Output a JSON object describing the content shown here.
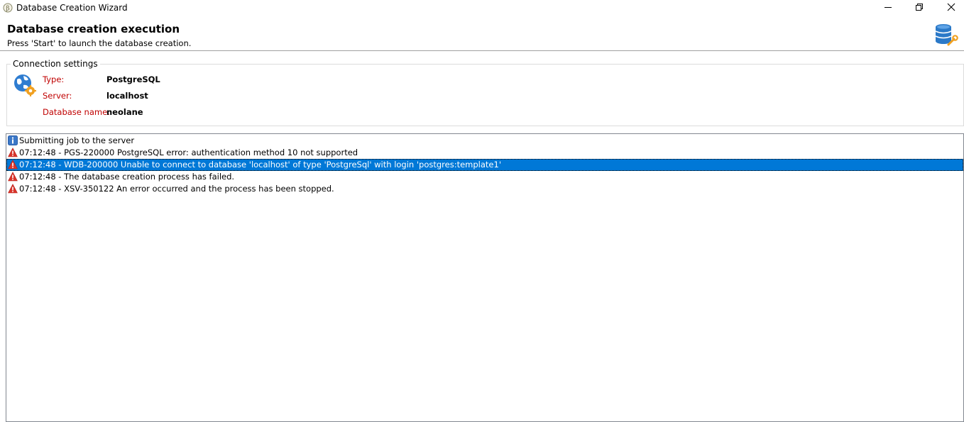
{
  "window": {
    "title": "Database Creation Wizard",
    "minimize_icon": "minimize-icon",
    "maximize_icon": "restore-icon",
    "close_icon": "close-icon"
  },
  "header": {
    "title": "Database creation execution",
    "subtitle": "Press 'Start' to launch the database creation.",
    "icon": "database-wrench-icon"
  },
  "connection": {
    "legend": "Connection settings",
    "icon": "globe-gear-icon",
    "fields": [
      {
        "label": "Type:",
        "value": "PostgreSQL"
      },
      {
        "label": "Server:",
        "value": "localhost"
      },
      {
        "label": "Database name:",
        "value": "neolane"
      }
    ]
  },
  "log": {
    "selected_index": 2,
    "rows": [
      {
        "icon": "info-icon",
        "text": "Submitting job to the server"
      },
      {
        "icon": "warning-icon",
        "text": "07:12:48 - PGS-220000 PostgreSQL error: authentication method 10 not supported"
      },
      {
        "icon": "warning-icon",
        "text": "07:12:48 - WDB-200000 Unable to connect to database 'localhost' of type 'PostgreSql' with login 'postgres:template1'"
      },
      {
        "icon": "warning-icon",
        "text": "07:12:48 - The database creation process has failed."
      },
      {
        "icon": "warning-icon",
        "text": "07:12:48 - XSV-350122 An error occurred and the process has been stopped."
      }
    ]
  },
  "colors": {
    "label_red": "#c00000",
    "selection_blue": "#0078d7",
    "warning_red": "#d9342b",
    "info_blue": "#3c78c8"
  }
}
